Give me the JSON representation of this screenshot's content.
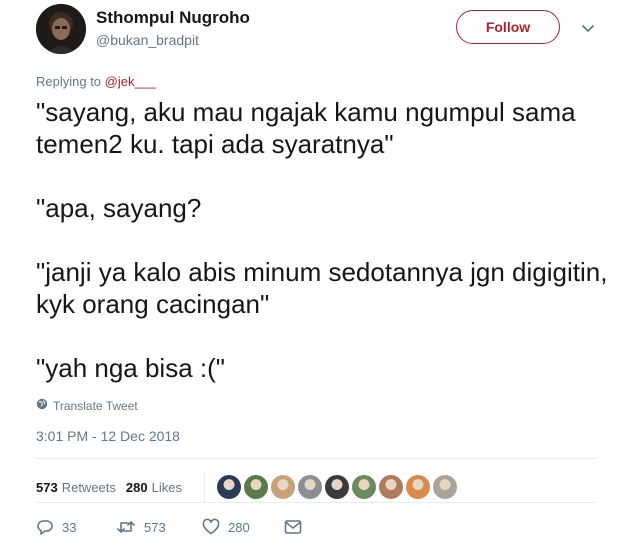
{
  "author": {
    "display_name": "Sthompul Nugroho",
    "handle": "@bukan_bradpit"
  },
  "follow_label": "Follow",
  "replying": {
    "prefix": "Replying to ",
    "mention": "@jek___"
  },
  "tweet": {
    "lines": [
      "\"sayang, aku mau ngajak kamu ngumpul sama temen2 ku. tapi ada syaratnya\"",
      "\"apa, sayang?",
      "\"janji ya kalo abis minum sedotannya jgn digigitin, kyk orang cacingan\"",
      "\"yah nga bisa :(\""
    ]
  },
  "translate_label": "Translate Tweet",
  "timestamp": "3:01 PM - 12 Dec 2018",
  "stats": {
    "retweets_count": "573",
    "retweets_label": "Retweets",
    "likes_count": "280",
    "likes_label": "Likes"
  },
  "liker_avatar_colors": [
    "#2b3a55",
    "#5a7a4a",
    "#c9a27a",
    "#8a8f94",
    "#3a3a3a",
    "#6d8a5e",
    "#b07a5c",
    "#d88a4a",
    "#a9a39c"
  ],
  "actions": {
    "reply_count": "33",
    "retweet_count": "573",
    "like_count": "280"
  },
  "colors": {
    "accent": "#b1212b",
    "muted": "#657786",
    "text": "#14171a"
  }
}
